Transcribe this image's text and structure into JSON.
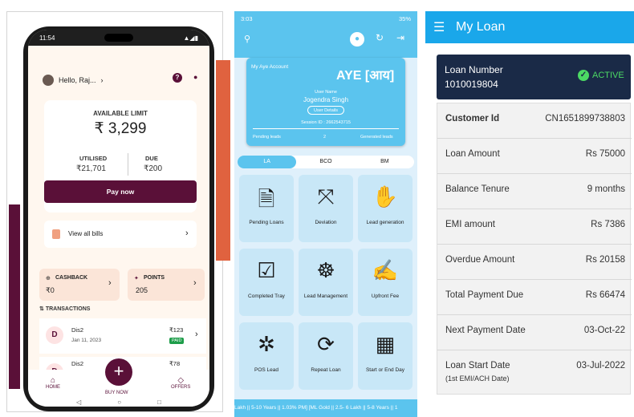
{
  "phone": {
    "status_time": "11:54",
    "greeting": "Hello, Raj...",
    "limit_title": "AVAILABLE LIMIT",
    "limit_value": "₹ 3,299",
    "utilised_label": "UTILISED",
    "utilised_value": "₹21,701",
    "due_label": "DUE",
    "due_value": "₹200",
    "pay_now": "Pay now",
    "view_bills": "View all bills",
    "cashback_label": "CASHBACK",
    "cashback_value": "₹0",
    "points_label": "POINTS",
    "points_value": "205",
    "transactions_label": "TRANSACTIONS",
    "transactions": [
      {
        "initial": "D",
        "name": "Dis2",
        "date": "Jan 11, 2023",
        "amount": "₹123",
        "badge": "PAID"
      },
      {
        "initial": "D",
        "name": "Dis2",
        "date": "",
        "amount": "₹78",
        "badge": ""
      }
    ],
    "nav": {
      "home": "HOME",
      "buy_now": "BUY NOW",
      "offers": "OFFERS"
    },
    "accent": "#5a1038"
  },
  "aye": {
    "status_time": "3:03",
    "battery": "35%",
    "account_label": "My Aye Account",
    "brand": "AYE [आय]",
    "user_name_label": "User Name",
    "user_name": "Jogendra Singh",
    "user_details": "User Details",
    "session": "Session ID : 2662543715",
    "pending_leads": "Pending leads",
    "pending_count": "2",
    "generated_leads": "Generated leads",
    "tabs": [
      "LA",
      "BCO",
      "BM"
    ],
    "tiles": [
      {
        "label": "Pending Loans",
        "icon": "document-clock-icon"
      },
      {
        "label": "Deviation",
        "icon": "split-arrow-icon"
      },
      {
        "label": "Lead generation",
        "icon": "hand-money-icon"
      },
      {
        "label": "Completed Tray",
        "icon": "tray-check-icon"
      },
      {
        "label": "Lead Management",
        "icon": "team-network-icon"
      },
      {
        "label": "Upfront Fee",
        "icon": "hand-card-icon"
      },
      {
        "label": "POS Lead",
        "icon": "group-icon"
      },
      {
        "label": "Repeat Loan",
        "icon": "repeat-icon"
      },
      {
        "label": "Start or End Day",
        "icon": "calendar-person-icon"
      }
    ],
    "ticker": "Lakh || 5-10 Years || 1.03% PM] [ML Gold || 2.5- 6 Lakh || 5-8 Years || 1",
    "accent": "#5bc4ee"
  },
  "loan": {
    "title": "My Loan",
    "loan_number_label": "Loan Number",
    "loan_number": "1010019804",
    "status": "ACTIVE",
    "rows": [
      {
        "label": "Customer Id",
        "value": "CN1651899738803",
        "bold": true
      },
      {
        "label": "Loan Amount",
        "value": "Rs 75000"
      },
      {
        "label": "Balance Tenure",
        "value": "9 months"
      },
      {
        "label": "EMI amount",
        "value": "Rs 7386"
      },
      {
        "label": "Overdue Amount",
        "value": "Rs 20158"
      },
      {
        "label": "Total Payment Due",
        "value": "Rs 66474"
      },
      {
        "label": "Next Payment Date",
        "value": "03-Oct-22"
      },
      {
        "label": "Loan Start Date",
        "value": "03-Jul-2022",
        "sub": "(1st EMI/ACH Date)"
      }
    ],
    "header_color": "#1aa7ea",
    "card_color": "#1a2a47"
  }
}
